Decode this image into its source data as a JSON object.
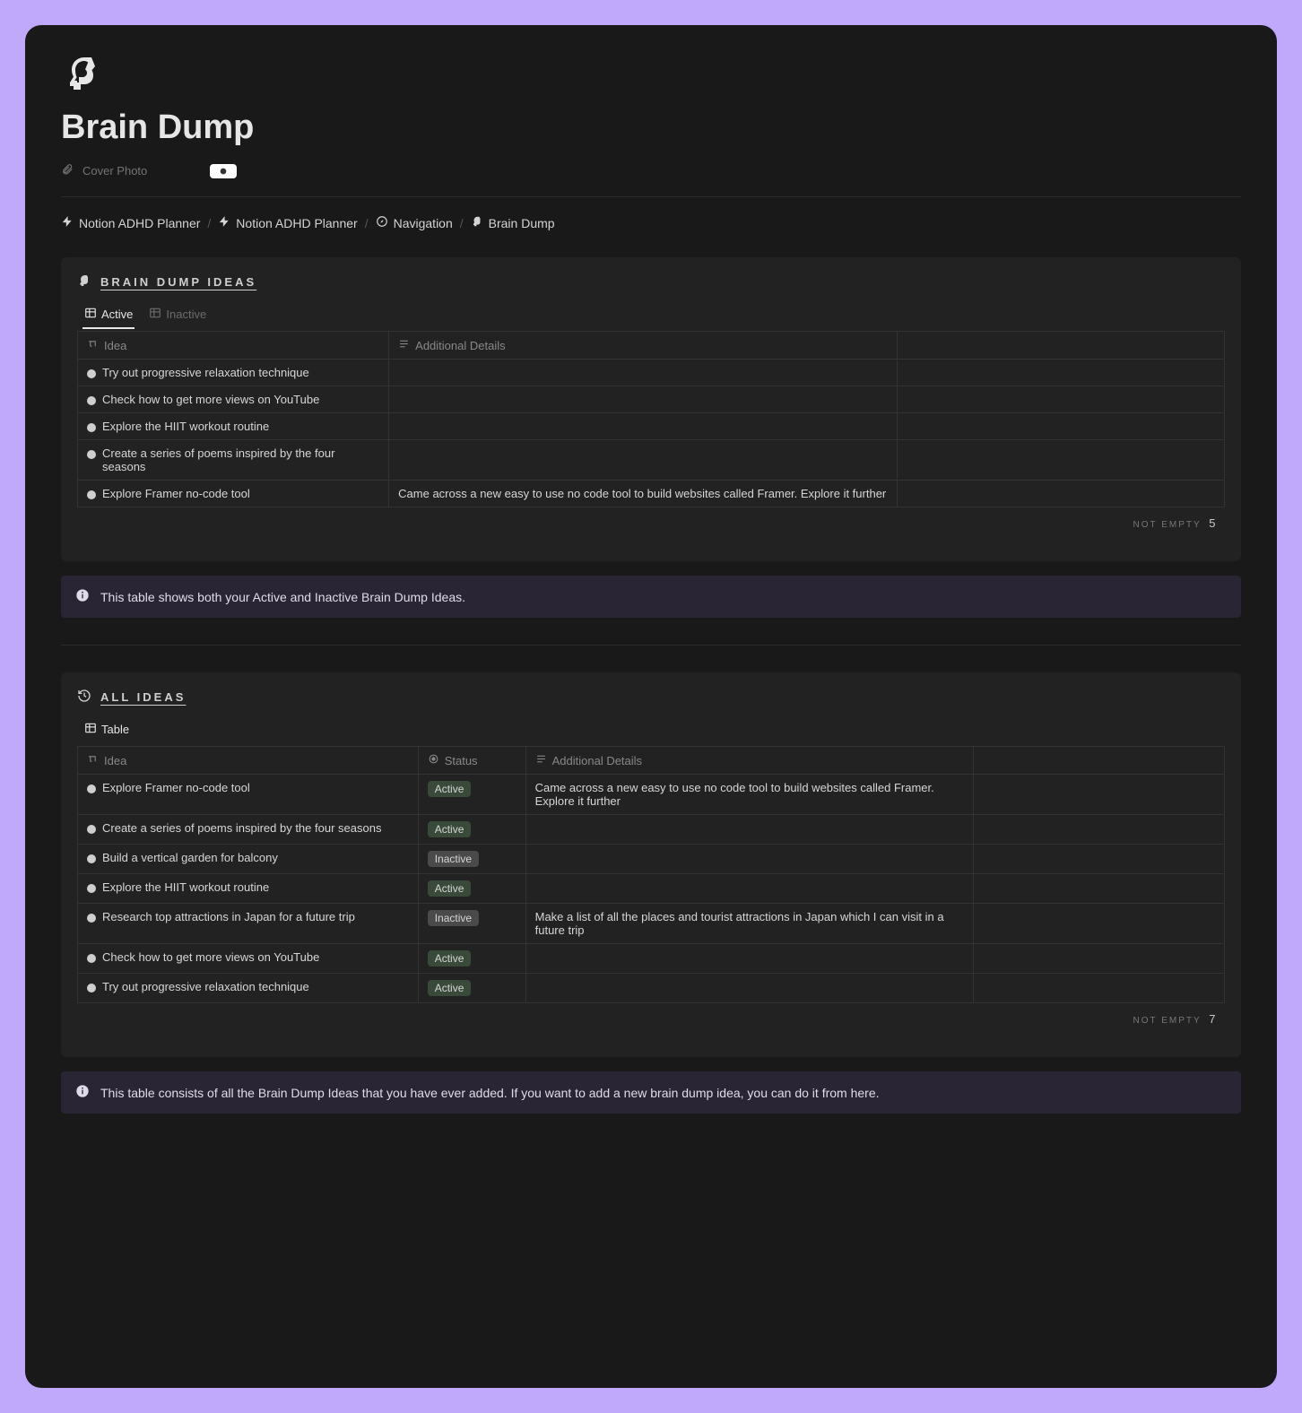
{
  "page": {
    "title": "Brain Dump",
    "cover_label": "Cover Photo"
  },
  "breadcrumb": {
    "items": [
      {
        "label": "Notion ADHD Planner",
        "icon": "bolt"
      },
      {
        "label": "Notion ADHD Planner",
        "icon": "bolt"
      },
      {
        "label": "Navigation",
        "icon": "compass"
      },
      {
        "label": "Brain Dump",
        "icon": "head"
      }
    ]
  },
  "section1": {
    "title": "BRAIN DUMP IDEAS",
    "tabs": [
      {
        "label": "Active",
        "active": true
      },
      {
        "label": "Inactive",
        "active": false
      }
    ],
    "columns": {
      "idea": "Idea",
      "details": "Additional Details"
    },
    "rows": [
      {
        "idea": "Try out progressive relaxation technique",
        "details": ""
      },
      {
        "idea": "Check how to get more views on YouTube",
        "details": ""
      },
      {
        "idea": "Explore the HIIT workout routine",
        "details": ""
      },
      {
        "idea": "Create a series of poems inspired by the four seasons",
        "details": ""
      },
      {
        "idea": "Explore Framer no-code tool",
        "details": "Came across a new easy to use no code tool to build websites called Framer. Explore it further"
      }
    ],
    "footer_label": "NOT EMPTY",
    "footer_count": "5"
  },
  "callout1": {
    "text": "This table shows both your Active and Inactive Brain Dump Ideas."
  },
  "section2": {
    "title": "ALL IDEAS",
    "tab": {
      "label": "Table"
    },
    "columns": {
      "idea": "Idea",
      "status": "Status",
      "details": "Additional Details"
    },
    "rows": [
      {
        "idea": "Explore Framer no-code tool",
        "status": "Active",
        "details": "Came across a new easy to use no code tool to build websites called Framer. Explore it further"
      },
      {
        "idea": "Create a series of poems inspired by the four seasons",
        "status": "Active",
        "details": ""
      },
      {
        "idea": "Build a vertical garden for balcony",
        "status": "Inactive",
        "details": ""
      },
      {
        "idea": "Explore the HIIT workout routine",
        "status": "Active",
        "details": ""
      },
      {
        "idea": "Research top attractions in Japan for a future trip",
        "status": "Inactive",
        "details": "Make a list of all the places and tourist attractions in Japan which I can visit in a future trip"
      },
      {
        "idea": "Check how to get more views on YouTube",
        "status": "Active",
        "details": ""
      },
      {
        "idea": "Try out progressive relaxation technique",
        "status": "Active",
        "details": ""
      }
    ],
    "footer_label": "NOT EMPTY",
    "footer_count": "7"
  },
  "callout2": {
    "text": "This table consists of all the Brain Dump Ideas that you have ever added. If you want to add a new brain dump idea, you can do it from here."
  }
}
